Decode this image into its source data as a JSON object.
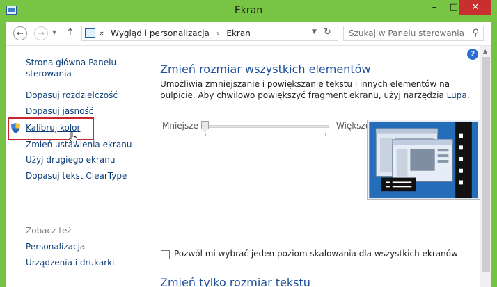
{
  "window": {
    "title": "Ekran"
  },
  "titlebar": {
    "minimize": "–",
    "maximize": "□",
    "close": "✕"
  },
  "nav": {
    "breadcrumb_prefix": "«",
    "breadcrumb": [
      "Wygląd i personalizacja",
      "Ekran"
    ],
    "separator": "›",
    "search_placeholder": "Szukaj w Panelu sterowania"
  },
  "sidebar": {
    "home": "Strona główna Panelu sterowania",
    "items": [
      "Dopasuj rozdzielczość",
      "Dopasuj jasność",
      "Kalibruj kolor",
      "Zmień ustawienia ekranu",
      "Użyj drugiego ekranu",
      "Dopasuj tekst ClearType"
    ],
    "see_also_title": "Zobacz też",
    "see_also": [
      "Personalizacja",
      "Urządzenia i drukarki"
    ]
  },
  "main": {
    "heading": "Zmień rozmiar wszystkich elementów",
    "description": "Umożliwia zmniejszanie i powiększanie tekstu i innych elementów na pulpicie. Aby chwilowo powiększyć fragment ekranu, użyj narzędzia",
    "description_link": "Lupa",
    "description_end": ".",
    "slider_min_label": "Mniejsze",
    "slider_max_label": "Większe",
    "slider_value": 0,
    "checkbox_label": "Pozwól mi wybrać jeden poziom skalowania dla wszystkich ekranów",
    "checkbox_checked": false,
    "next_heading": "Zmień tylko rozmiar tekstu"
  },
  "help": "?",
  "colors": {
    "frame": "#75c244",
    "close": "#c7302f",
    "link": "#0e3f7a",
    "heading": "#1e4f9a",
    "highlight": "#c8262c"
  }
}
